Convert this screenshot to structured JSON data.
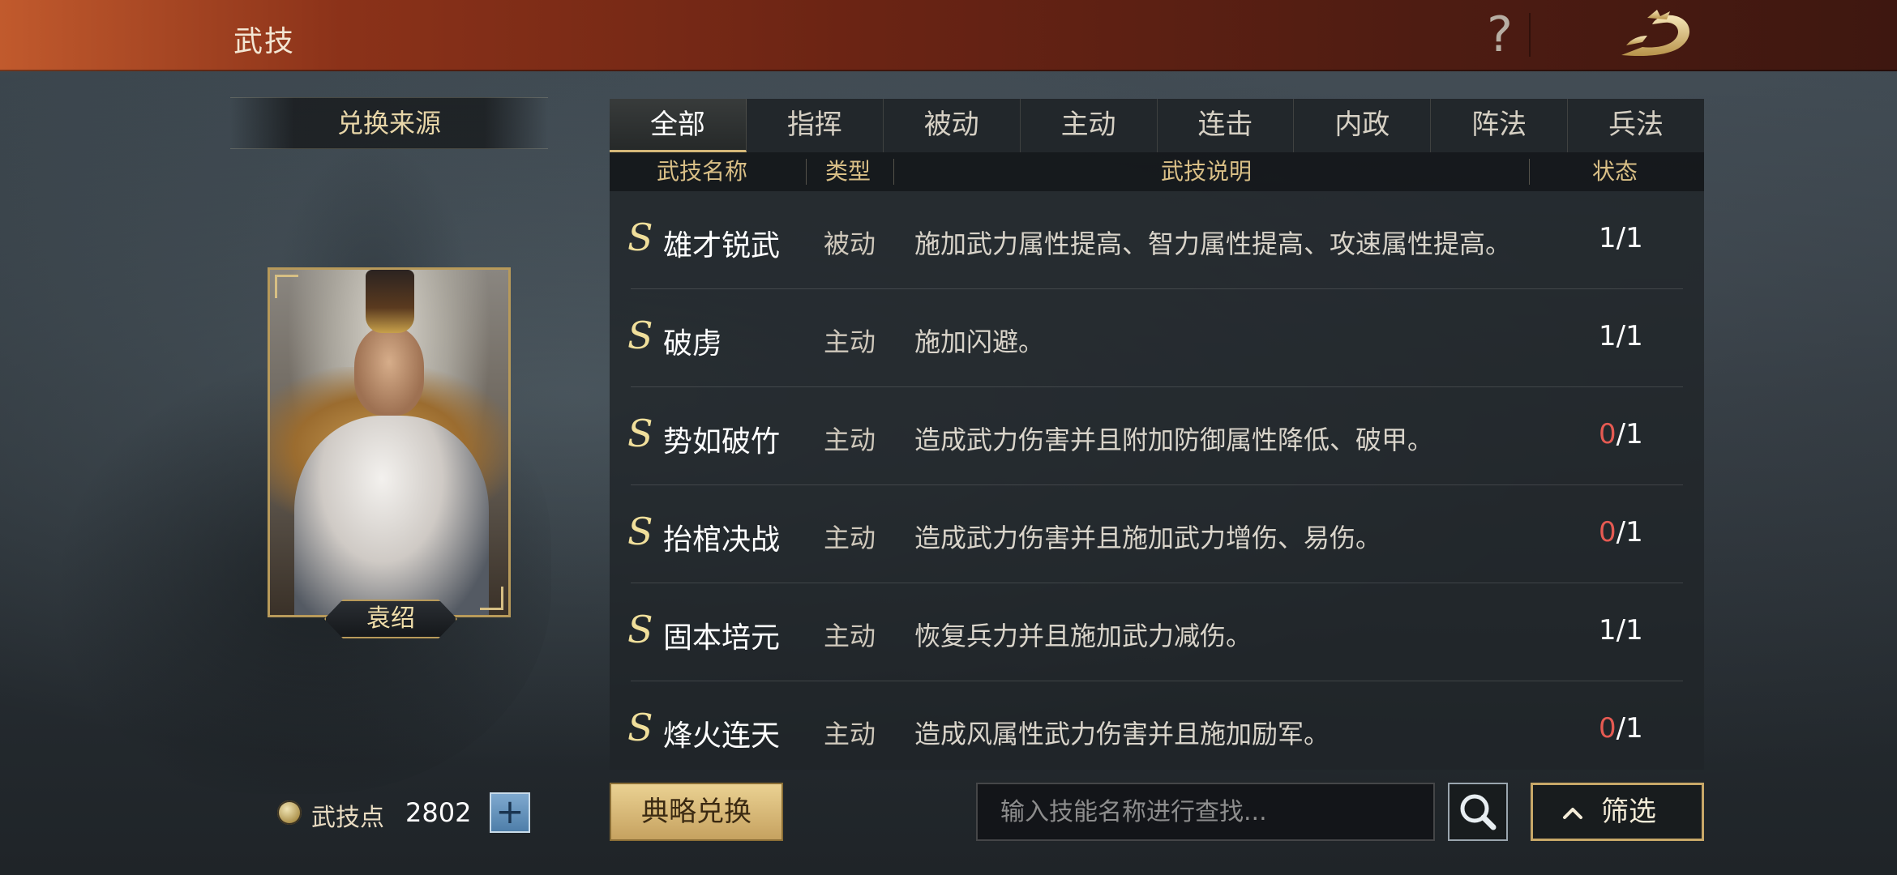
{
  "header": {
    "title": "武技"
  },
  "left": {
    "exchange_source_title": "兑换来源",
    "general_name": "袁绍",
    "points_label": "武技点",
    "points_value": "2802"
  },
  "tabs": [
    {
      "label": "全部",
      "active": true
    },
    {
      "label": "指挥",
      "active": false
    },
    {
      "label": "被动",
      "active": false
    },
    {
      "label": "主动",
      "active": false
    },
    {
      "label": "连击",
      "active": false
    },
    {
      "label": "内政",
      "active": false
    },
    {
      "label": "阵法",
      "active": false
    },
    {
      "label": "兵法",
      "active": false
    }
  ],
  "table": {
    "columns": {
      "name": "武技名称",
      "type": "类型",
      "desc": "武技说明",
      "status": "状态"
    },
    "rows": [
      {
        "grade": "S",
        "name": "雄才锐武",
        "type": "被动",
        "desc": "施加武力属性提高、智力属性提高、攻速属性提高。",
        "current": "1",
        "max": "1"
      },
      {
        "grade": "S",
        "name": "破虏",
        "type": "主动",
        "desc": "施加闪避。",
        "current": "1",
        "max": "1"
      },
      {
        "grade": "S",
        "name": "势如破竹",
        "type": "主动",
        "desc": "造成武力伤害并且附加防御属性降低、破甲。",
        "current": "0",
        "max": "1"
      },
      {
        "grade": "S",
        "name": "抬棺决战",
        "type": "主动",
        "desc": "造成武力伤害并且施加武力增伤、易伤。",
        "current": "0",
        "max": "1"
      },
      {
        "grade": "S",
        "name": "固本培元",
        "type": "主动",
        "desc": "恢复兵力并且施加武力减伤。",
        "current": "1",
        "max": "1"
      },
      {
        "grade": "S",
        "name": "烽火连天",
        "type": "主动",
        "desc": "造成风属性武力伤害并且施加励军。",
        "current": "0",
        "max": "1"
      }
    ]
  },
  "bottom": {
    "exchange_button": "典略兑换",
    "search_placeholder": "输入技能名称进行查找...",
    "filter_label": "筛选"
  },
  "colors": {
    "accent_gold": "#d4b778",
    "zero_status": "#e55a52",
    "topbar": "#6b2414"
  }
}
